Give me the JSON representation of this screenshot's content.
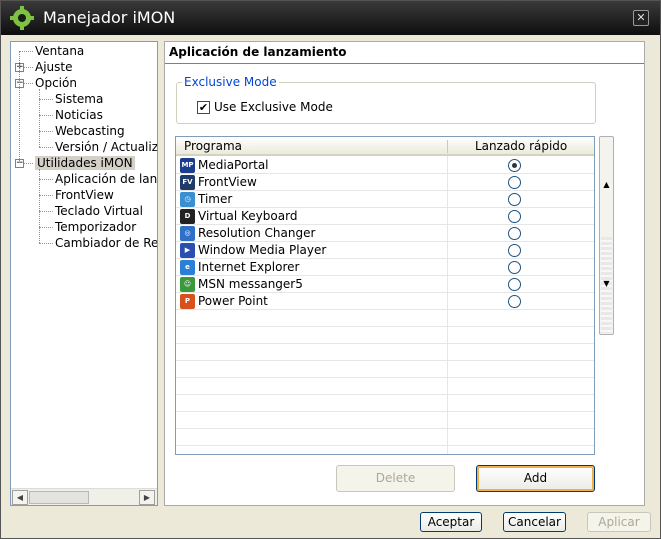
{
  "window": {
    "title": "Manejador iMON",
    "close_glyph": "✕"
  },
  "tree": {
    "items": [
      {
        "label": "Ventana",
        "level": 0,
        "expander": ""
      },
      {
        "label": "Ajuste",
        "level": 0,
        "expander": "+"
      },
      {
        "label": "Opción",
        "level": 0,
        "expander": "−"
      },
      {
        "label": "Sistema",
        "level": 1,
        "expander": ""
      },
      {
        "label": "Noticias",
        "level": 1,
        "expander": ""
      },
      {
        "label": "Webcasting",
        "level": 1,
        "expander": ""
      },
      {
        "label": "Versión / Actualiza",
        "level": 1,
        "expander": ""
      },
      {
        "label": "Utilidades iMON",
        "level": 0,
        "expander": "−",
        "selected": true
      },
      {
        "label": "Aplicación de lanza",
        "level": 1,
        "expander": ""
      },
      {
        "label": "FrontView",
        "level": 1,
        "expander": ""
      },
      {
        "label": "Teclado Virtual",
        "level": 1,
        "expander": ""
      },
      {
        "label": "Temporizador",
        "level": 1,
        "expander": ""
      },
      {
        "label": "Cambiador de Reso",
        "level": 1,
        "expander": ""
      }
    ]
  },
  "panel": {
    "title": "Aplicación de lanzamiento",
    "exclusive": {
      "legend": "Exclusive Mode",
      "checkbox_label": "Use Exclusive Mode",
      "checked": true
    },
    "grid": {
      "columns": [
        "Programa",
        "Lanzado rápido"
      ],
      "rows": [
        {
          "name": "MediaPortal",
          "icon": "mediaportal-icon",
          "quick": true
        },
        {
          "name": "FrontView",
          "icon": "frontview-icon",
          "quick": false
        },
        {
          "name": "Timer",
          "icon": "timer-icon",
          "quick": false
        },
        {
          "name": "Virtual Keyboard",
          "icon": "keyboard-icon",
          "quick": false
        },
        {
          "name": "Resolution Changer",
          "icon": "resolution-icon",
          "quick": false
        },
        {
          "name": "Window Media Player",
          "icon": "media-player-icon",
          "quick": false
        },
        {
          "name": "Internet Explorer",
          "icon": "ie-icon",
          "quick": false
        },
        {
          "name": "MSN messanger5",
          "icon": "msn-icon",
          "quick": false
        },
        {
          "name": "Power Point",
          "icon": "powerpoint-icon",
          "quick": false
        }
      ]
    },
    "delete_label": "Delete",
    "add_label": "Add"
  },
  "footer": {
    "accept_label": "Aceptar",
    "cancel_label": "Cancelar",
    "apply_label": "Aplicar"
  },
  "colors": {
    "title_bg": "#1a1a1a",
    "legend": "#0046d5",
    "focus": "#f0b050"
  }
}
